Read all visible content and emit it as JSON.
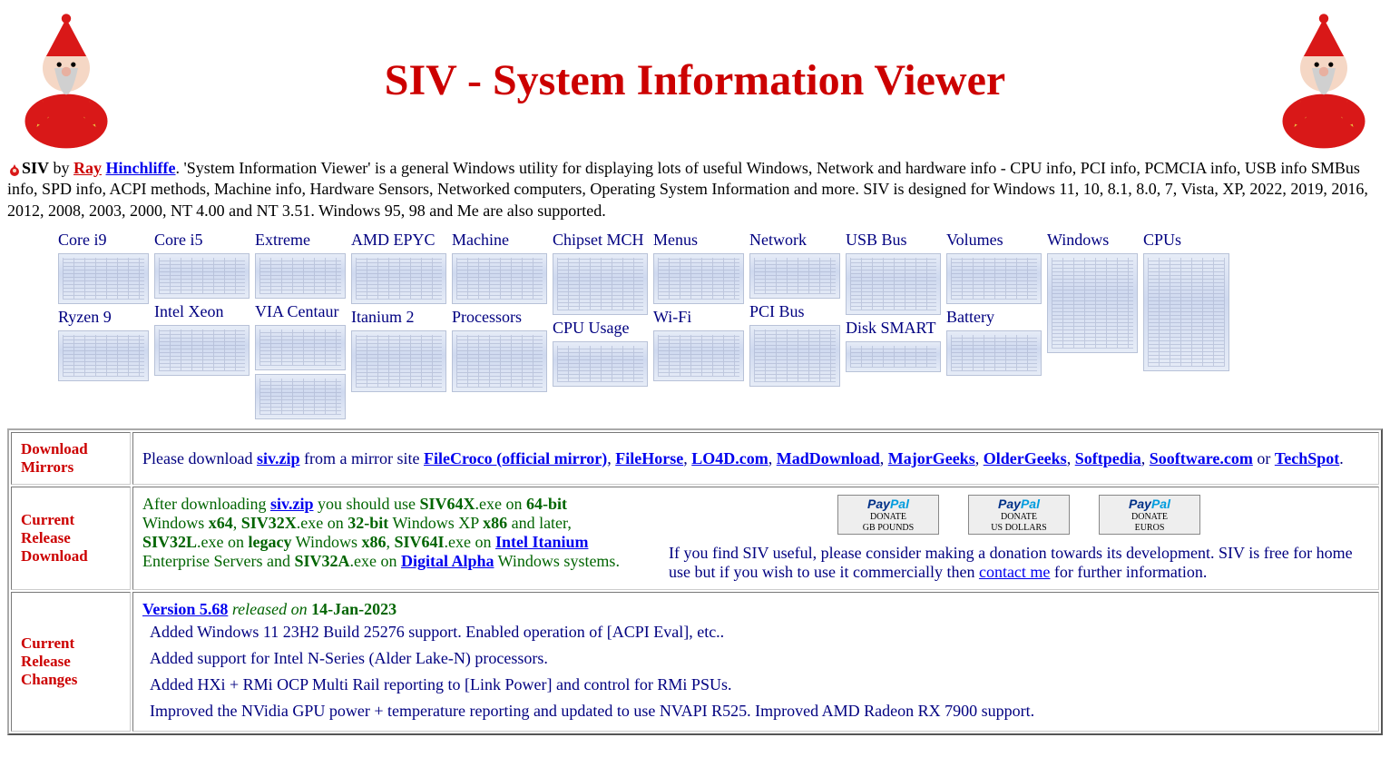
{
  "header": {
    "title": "SIV - System Information Viewer"
  },
  "intro": {
    "lead_bold": "SIV",
    "by": " by ",
    "author_first": "Ray",
    "author_last": "Hinchliffe",
    "rest": ". 'System Information Viewer' is a general Windows utility for displaying lots of useful Windows, Network and hardware info - CPU info, PCI info, PCMCIA info, USB info SMBus info, SPD info, ACPI methods, Machine info, Hardware Sensors, Networked computers, Operating System Information and more. SIV is designed for Windows 11, 10, 8.1, 8.0, 7, Vista, XP, 2022, 2019, 2016, 2012, 2008, 2003, 2000, NT 4.00 and NT 3.51. Windows 95, 98 and Me are also supported."
  },
  "thumbs": [
    [
      {
        "label": "Core i9",
        "w": "w100",
        "h": "h56"
      },
      {
        "label": "Ryzen 9",
        "w": "w100",
        "h": "h56"
      }
    ],
    [
      {
        "label": "Core i5",
        "w": "w105",
        "h": "h50"
      },
      {
        "label": "Intel Xeon",
        "w": "w105",
        "h": "h56"
      }
    ],
    [
      {
        "label": "Extreme",
        "w": "w100",
        "h": "h50"
      },
      {
        "label": "VIA Centaur",
        "w": "w100",
        "h": "h50"
      },
      {
        "label": "",
        "w": "w100",
        "h": "h50"
      }
    ],
    [
      {
        "label": "AMD EPYC",
        "w": "w105",
        "h": "h56"
      },
      {
        "label": "Itanium 2",
        "w": "w105",
        "h": "h68"
      }
    ],
    [
      {
        "label": "Machine",
        "w": "w105",
        "h": "h56"
      },
      {
        "label": "Processors",
        "w": "w105",
        "h": "h68"
      }
    ],
    [
      {
        "label": "Chipset MCH",
        "w": "w105",
        "h": "h68"
      },
      {
        "label": "CPU Usage",
        "w": "w105",
        "h": "h50"
      }
    ],
    [
      {
        "label": "Menus",
        "w": "w100",
        "h": "h56"
      },
      {
        "label": "Wi-Fi",
        "w": "w100",
        "h": "h56"
      }
    ],
    [
      {
        "label": "Network",
        "w": "w100",
        "h": "h50"
      },
      {
        "label": "PCI Bus",
        "w": "w100",
        "h": "h68"
      }
    ],
    [
      {
        "label": "USB Bus",
        "w": "w105",
        "h": "h68"
      },
      {
        "label": "Disk SMART",
        "w": "w105",
        "h": "h34"
      }
    ],
    [
      {
        "label": "Volumes",
        "w": "w105",
        "h": "h56"
      },
      {
        "label": "Battery",
        "w": "w105",
        "h": "h50"
      }
    ],
    [
      {
        "label": "Windows",
        "w": "w100",
        "h": "h110"
      }
    ],
    [
      {
        "label": "CPUs",
        "w": "w95",
        "h": "h130"
      }
    ]
  ],
  "mirrors": {
    "header": "Download Mirrors",
    "pre": "Please download ",
    "zip": "siv.zip",
    "mid": " from a mirror site ",
    "list": [
      {
        "name": "FileCroco (official mirror)",
        "sep": ", "
      },
      {
        "name": "FileHorse",
        "sep": ", "
      },
      {
        "name": "LO4D.com",
        "sep": ", "
      },
      {
        "name": "MadDownload",
        "sep": ", "
      },
      {
        "name": "MajorGeeks",
        "sep": ", "
      },
      {
        "name": "OlderGeeks",
        "sep": ", "
      },
      {
        "name": "Softpedia",
        "sep": ", "
      },
      {
        "name": "Sooftware.com",
        "sep": " or "
      },
      {
        "name": "TechSpot",
        "sep": "."
      }
    ]
  },
  "release": {
    "header": "Current Release Download",
    "t1a": "After downloading ",
    "zip": "siv.zip",
    "t1b": " you should use ",
    "exe64": "SIV64X",
    "t1c": ".exe on ",
    "bit64": "64-bit",
    "t2a": "Windows ",
    "x64": "x64",
    "t2b": ", ",
    "exe32x": "SIV32X",
    "t2c": ".exe on ",
    "bit32": "32-bit",
    "t2d": " Windows XP ",
    "x86": "x86",
    "t2e": " and later,",
    "t3a": "",
    "exe32l": "SIV32L",
    "t3b": ".exe on ",
    "legacy": "legacy",
    "t3c": " Windows ",
    "x86b": "x86",
    "t3d": ", ",
    "exe64i": "SIV64I",
    "t3e": ".exe on ",
    "itanium": "Intel Itanium",
    "t4a": "Enterprise Servers and ",
    "exe32a": "SIV32A",
    "t4b": ".exe on ",
    "alpha": "Digital Alpha",
    "t4c": " Windows systems.",
    "donate_gb": "GB POUNDS",
    "donate_us": "US DOLLARS",
    "donate_eu": "EUROS",
    "donate_word": "DONATE",
    "info_a": "If you find SIV useful, please consider making a donation towards its development. SIV is free for home use but if you wish to use it commercially then ",
    "contact": "contact me",
    "info_b": " for further information."
  },
  "changes": {
    "header": "Current Release Changes",
    "version_link": "Version 5.68",
    "released_on": " released on ",
    "date": "14-Jan-2023",
    "items": [
      "Added Windows 11 23H2 Build 25276 support. Enabled operation of [ACPI Eval], etc..",
      "Added support for Intel N-Series (Alder Lake-N) processors.",
      "Added HXi + RMi OCP Multi Rail reporting to [Link Power] and control for RMi PSUs.",
      "Improved the NVidia GPU power + temperature reporting and updated to use NVAPI R525. Improved AMD Radeon RX 7900 support."
    ]
  }
}
